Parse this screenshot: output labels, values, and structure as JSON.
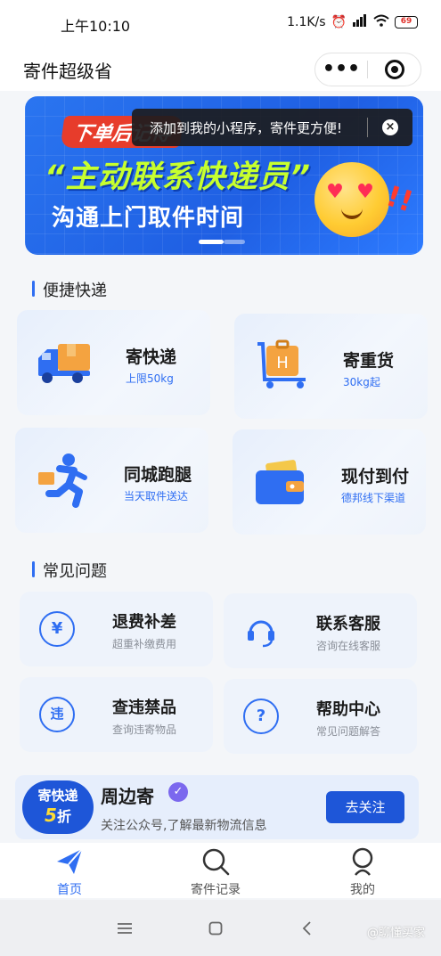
{
  "status": {
    "time": "上午10:10",
    "speed": "1.1K/s",
    "battery": "69",
    "icons": [
      "alarm-icon",
      "hd-signal-icon",
      "wifi-icon",
      "battery-icon"
    ]
  },
  "header": {
    "title": "寄件超级省",
    "more_icon": "more-dots-icon",
    "target_icon": "target-icon"
  },
  "banner": {
    "tag": "下单后记得",
    "headline": "“主动联系快递员”",
    "subline": "沟通上门取件时间",
    "emoji": "heart-eyes-emoji"
  },
  "tooltip": {
    "text": "添加到我的小程序，寄件更方便!",
    "close": "×"
  },
  "sections": {
    "quick": "便捷快递",
    "faq": "常见问题"
  },
  "services": [
    {
      "title": "寄快递",
      "sub": "上限50kg",
      "icon": "truck-icon"
    },
    {
      "title": "寄重货",
      "sub": "30kg起",
      "icon": "cart-icon"
    },
    {
      "title": "同城跑腿",
      "sub": "当天取件送达",
      "icon": "runner-icon"
    },
    {
      "title": "现付到付",
      "sub": "德邦线下渠道",
      "icon": "wallet-icon"
    }
  ],
  "faqs": [
    {
      "title": "退费补差",
      "sub": "超重补缴费用",
      "icon_char": "¥"
    },
    {
      "title": "联系客服",
      "sub": "咨询在线客服",
      "icon_char": "☊"
    },
    {
      "title": "查违禁品",
      "sub": "查询违寄物品",
      "icon_char": "违"
    },
    {
      "title": "帮助中心",
      "sub": "常见问题解答",
      "icon_char": "?"
    }
  ],
  "follow": {
    "badge_top": "寄快递",
    "badge_num": "5",
    "badge_unit": "折",
    "title": "周边寄",
    "subtitle": "关注公众号,了解最新物流信息",
    "button": "去关注"
  },
  "tabs": [
    {
      "label": "首页",
      "icon": "paper-plane-icon"
    },
    {
      "label": "寄件记录",
      "icon": "search-icon"
    },
    {
      "label": "我的",
      "icon": "user-icon"
    }
  ],
  "watermark": "@聊懂买家",
  "colors": {
    "accent": "#2f6ef2",
    "banner": "#2a75f0",
    "headline": "#c7ff2e",
    "tag": "#e73c2b"
  }
}
